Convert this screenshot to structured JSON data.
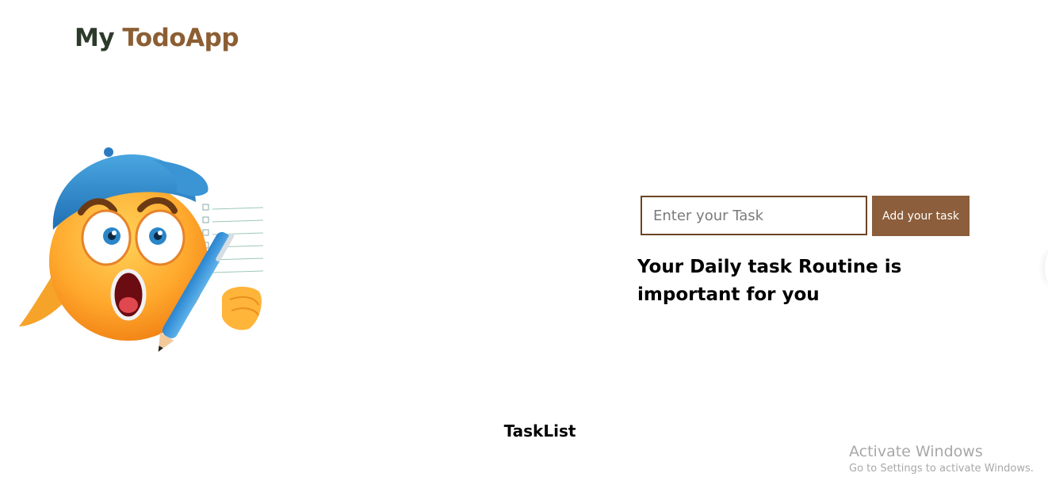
{
  "header": {
    "brand_part1": "My ",
    "brand_part2": "TodoApp"
  },
  "hero": {
    "icon": "shocked-emoji-with-cap-and-pen-icon"
  },
  "form": {
    "placeholder": "Enter your Task",
    "value": "",
    "button_label": "Add your task"
  },
  "tagline": "Your Daily task Routine is important for you",
  "tasklist": {
    "title": "TaskList",
    "items": []
  },
  "watermark": {
    "line1": "Activate Windows",
    "line2": "Go to Settings to activate Windows."
  },
  "colors": {
    "brand_dark": "#2c3a2a",
    "brand_accent": "#8c5e33",
    "button_bg": "#8c5e3b",
    "input_border": "#6b4423"
  }
}
